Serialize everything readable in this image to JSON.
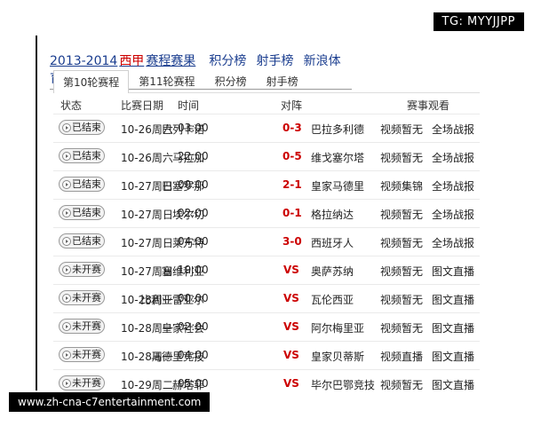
{
  "watermark_top": "TG: MYYJJPP",
  "watermark_bottom": "www.zh-cna-c7entertainment.com",
  "header": {
    "season_prefix": "2013-2014",
    "season_red": "西甲",
    "season_suffix": "赛程赛果",
    "link_standings": "积分榜",
    "link_scorers": "射手榜",
    "link_source": "新浪体育"
  },
  "tabs": [
    {
      "label": "第10轮赛程"
    },
    {
      "label": "第11轮赛程"
    },
    {
      "label": "积分榜"
    },
    {
      "label": "射手榜"
    }
  ],
  "columns": {
    "status": "状态",
    "date": "比赛日期",
    "time": "时间",
    "matchup": "对阵",
    "watch": "赛事观看"
  },
  "matches": [
    {
      "status": "已结束",
      "date": "10-26周六",
      "time": "03:00",
      "home": "巴列卡诺",
      "score": "0-3",
      "away": "巴拉多利德",
      "video": "视频暂无",
      "report": "全场战报"
    },
    {
      "status": "已结束",
      "date": "10-26周六",
      "time": "22:00",
      "home": "马拉加",
      "score": "0-5",
      "away": "维戈塞尔塔",
      "video": "视频暂无",
      "report": "全场战报"
    },
    {
      "status": "已结束",
      "date": "10-27周日",
      "time": "00:00",
      "home": "巴塞罗那",
      "score": "2-1",
      "away": "皇家马德里",
      "video": "视频集锦",
      "report": "全场战报"
    },
    {
      "status": "已结束",
      "date": "10-27周日",
      "time": "02:00",
      "home": "埃尔切",
      "score": "0-1",
      "away": "格拉纳达",
      "video": "视频暂无",
      "report": "全场战报"
    },
    {
      "status": "已结束",
      "date": "10-27周日",
      "time": "04:00",
      "home": "莱万特",
      "score": "3-0",
      "away": "西班牙人",
      "video": "视频暂无",
      "report": "全场战报"
    },
    {
      "status": "未开赛",
      "date": "10-27周日",
      "time": "19:00",
      "home": "塞维利亚",
      "score": "VS",
      "away": "奥萨苏纳",
      "video": "视频暂无",
      "report": "图文直播"
    },
    {
      "status": "未开赛",
      "date": "10-28周一",
      "time": "00:00",
      "home": "比利亚雷亚尔",
      "score": "VS",
      "away": "瓦伦西亚",
      "video": "视频暂无",
      "report": "图文直播"
    },
    {
      "status": "未开赛",
      "date": "10-28周一",
      "time": "02:00",
      "home": "皇家社会",
      "score": "VS",
      "away": "阿尔梅里亚",
      "video": "视频暂无",
      "report": "图文直播"
    },
    {
      "status": "未开赛",
      "date": "10-28周一",
      "time": "04:00",
      "home": "马德里竞技",
      "score": "VS",
      "away": "皇家贝蒂斯",
      "video": "视频直播",
      "report": "图文直播"
    },
    {
      "status": "未开赛",
      "date": "10-29周二",
      "time": "05:00",
      "home": "赫塔菲",
      "score": "VS",
      "away": "毕尔巴鄂竞技",
      "video": "视频暂无",
      "report": "图文直播"
    }
  ]
}
